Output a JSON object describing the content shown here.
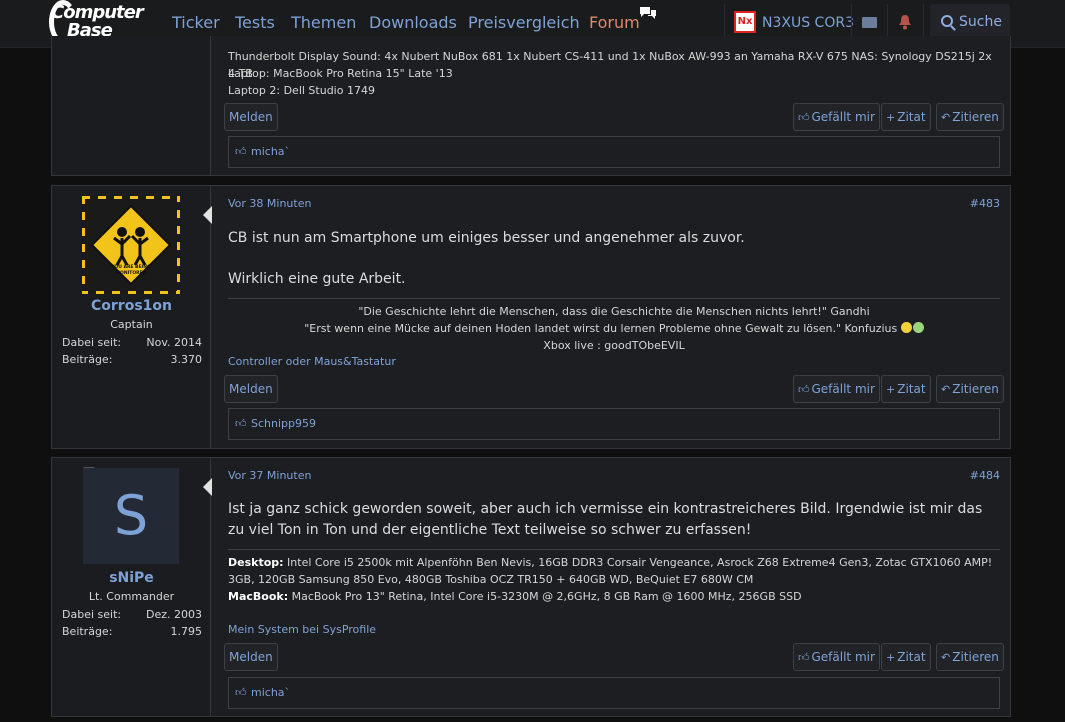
{
  "nav": {
    "logo_line1": "Computer",
    "logo_line2": "Base",
    "items": [
      "Ticker",
      "Tests",
      "Themen",
      "Downloads",
      "Preisvergleich",
      "Forum"
    ],
    "user_avatar_text": "Nx",
    "user_name": "N3XUS COR3",
    "search_label": "Suche"
  },
  "post_prev": {
    "sig_line1": "Thunderbolt Display Sound: 4x Nubert NuBox 681 1x Nubert CS-411 und 1x NuBox AW-993 an Yamaha RX-V 675 NAS: Synology DS215j 2x 4 TB",
    "sig_line2": "Laptop: MacBook Pro Retina 15\" Late '13",
    "sig_line3": "Laptop 2: Dell Studio 1749",
    "report": "Melden",
    "like": "Gefällt mir",
    "quote": "Zitat",
    "reply": "Zitieren",
    "liked_by": "micha`"
  },
  "post_483": {
    "time": "Vor 38 Minuten",
    "number": "#483",
    "author": "Corros1on",
    "rank": "Captain",
    "joined_label": "Dabei seit:",
    "joined": "Nov. 2014",
    "posts_label": "Beiträge:",
    "posts": "3.370",
    "avatar_caption": "YOU ARE BEING MONITORED",
    "body1": "CB ist nun am Smartphone um einiges besser und angenehmer als zuvor.",
    "body2": "Wirklich eine gute Arbeit.",
    "sig1": "\"Die Geschichte lehrt die Menschen, dass die Geschichte die Menschen nichts lehrt!\" Gandhi",
    "sig2": "\"Erst wenn eine Mücke auf deinen Hoden landet wirst du lernen Probleme ohne Gewalt zu lösen.\" Konfuzius",
    "sig3": "Xbox live : goodTObeEVIL",
    "system_link": "Controller oder Maus&Tastatur",
    "report": "Melden",
    "like": "Gefällt mir",
    "quote": "Zitat",
    "reply": "Zitieren",
    "liked_by": "Schnipp959"
  },
  "post_484": {
    "time": "Vor 37 Minuten",
    "number": "#484",
    "author": "sNiPe",
    "avatar_letter": "S",
    "rank": "Lt. Commander",
    "joined_label": "Dabei seit:",
    "joined": "Dez. 2003",
    "posts_label": "Beiträge:",
    "posts": "1.795",
    "body": "Ist ja ganz schick geworden soweit, aber auch ich vermisse ein kontrastreicheres Bild. Irgendwie ist mir das zu viel Ton in Ton und der eigentliche Text teilweise so schwer zu erfassen!",
    "sig_desktop_label": "Desktop:",
    "sig_desktop": "Intel Core i5 2500k mit Alpenföhn Ben Nevis, 16GB DDR3 Corsair Vengeance, Asrock Z68 Extreme4 Gen3, Zotac GTX1060 AMP! 3GB, 120GB Samsung 850 Evo, 480GB Toshiba OCZ TR150 + 640GB WD, BeQuiet E7 680W CM",
    "sig_macbook_label": "MacBook:",
    "sig_macbook": "MacBook Pro 13\" Retina, Intel Core i5-3230M @ 2,6GHz, 8 GB Ram @ 1600 MHz, 256GB SSD",
    "system_link": "Mein System bei SysProfile",
    "report": "Melden",
    "like": "Gefällt mir",
    "quote": "Zitat",
    "reply": "Zitieren",
    "liked_by": "micha`"
  }
}
